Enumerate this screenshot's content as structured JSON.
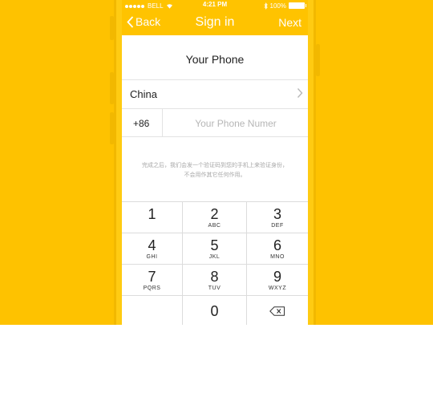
{
  "status_bar": {
    "carrier": "BELL",
    "time": "4:21 PM",
    "battery": "100%"
  },
  "nav": {
    "back_label": "Back",
    "title": "Sign in",
    "next_label": "Next"
  },
  "form": {
    "heading": "Your Phone",
    "country": "China",
    "country_code": "+86",
    "phone_placeholder": "Your Phone Numer",
    "phone_value": ""
  },
  "note": "完成之后，我们会发一个验证码到您的手机上来验证身份，不会用作其它任何作用。",
  "keypad": [
    {
      "num": "1",
      "letters": ""
    },
    {
      "num": "2",
      "letters": "ABC"
    },
    {
      "num": "3",
      "letters": "DEF"
    },
    {
      "num": "4",
      "letters": "GHI"
    },
    {
      "num": "5",
      "letters": "JKL"
    },
    {
      "num": "6",
      "letters": "MNO"
    },
    {
      "num": "7",
      "letters": "PQRS"
    },
    {
      "num": "8",
      "letters": "TUV"
    },
    {
      "num": "9",
      "letters": "WXYZ"
    },
    {
      "num": "0",
      "letters": ""
    }
  ],
  "colors": {
    "accent": "#FFC300",
    "background": "#FEC200"
  }
}
